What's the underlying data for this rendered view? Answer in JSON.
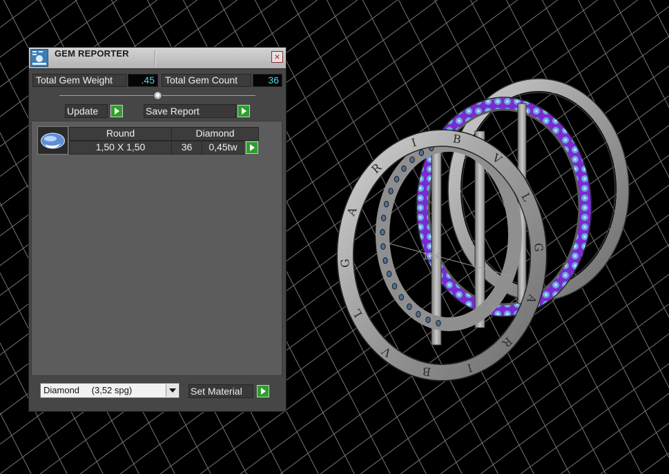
{
  "window": {
    "title": "GEM REPORTER",
    "close_glyph": "×"
  },
  "stats": {
    "weight_label": "Total Gem Weight",
    "weight_value": ".45",
    "count_label": "Total Gem Count",
    "count_value": "36"
  },
  "actions": {
    "update_label": "Update",
    "save_label": "Save Report"
  },
  "gem_table": {
    "rows": [
      {
        "shape": "Round",
        "material": "Diamond",
        "size": "1,50 X 1,50",
        "count": "36",
        "weight": "0,45tw"
      }
    ]
  },
  "material_select": {
    "name": "Diamond",
    "density": "(3,52 spg)",
    "set_label": "Set Material"
  },
  "viewport": {
    "measure_label": "13,0",
    "engraving": [
      "B",
      "V",
      "L",
      "G",
      "A",
      "R",
      "I"
    ]
  },
  "icons": [
    "app-icon",
    "close-icon",
    "gem-round-icon",
    "go-arrow-icon",
    "dropdown-arrow-icon",
    "slider-knob"
  ],
  "colors": {
    "panel_bg": "#464646",
    "value_text": "#55d6ea",
    "go_green": "#2f9e2f",
    "gem_blue": "#6aa7e0",
    "gem_purple": "#7a2bd0"
  }
}
